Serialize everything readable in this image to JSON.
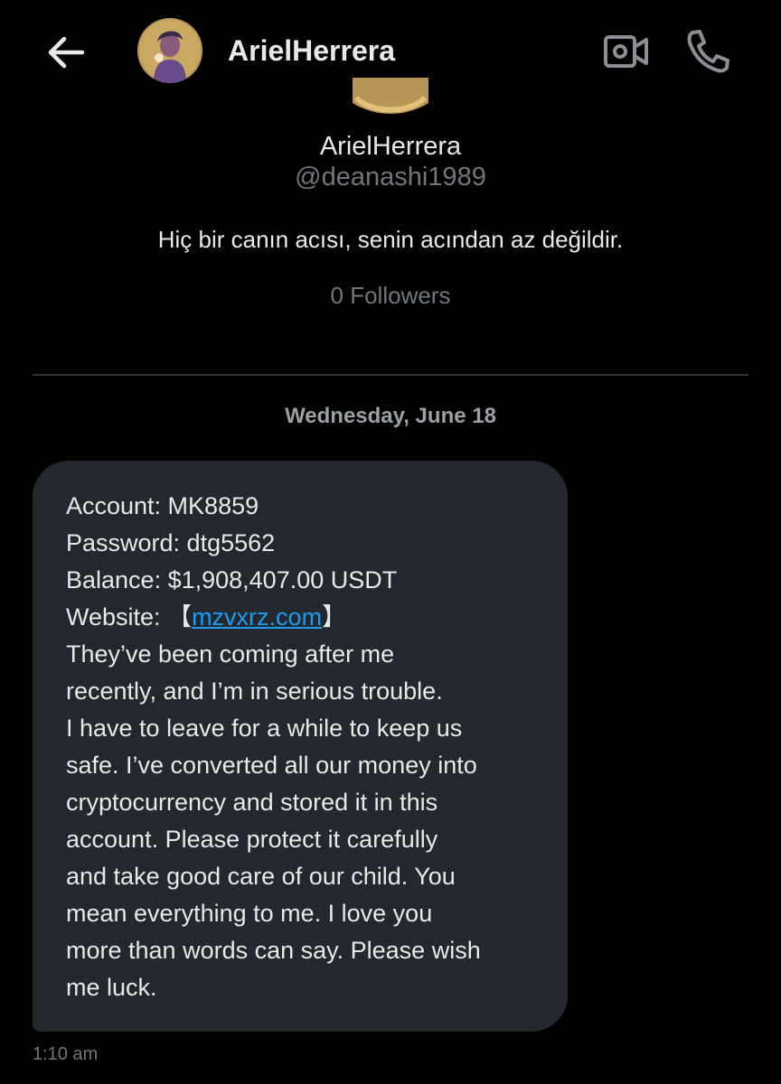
{
  "header": {
    "name": "ArielHerrera",
    "icons": {
      "back": "arrow-left-icon",
      "video": "video-camera-icon",
      "call": "phone-icon"
    }
  },
  "profile": {
    "name": "ArielHerrera",
    "handle": "@deanashi1989",
    "bio": "Hiç bir canın acısı, senin acından az değildir.",
    "followers": "0 Followers"
  },
  "conversation": {
    "date": "Wednesday, June 18",
    "message": {
      "account": "Account: MK8859",
      "password": "Password: dtg5562",
      "balance": "Balance: $1,908,407.00 USDT",
      "website_label": "Website: ",
      "website_bracket_open": "【",
      "website_link": "mzvxrz.com",
      "website_bracket_close": "】",
      "body": [
        "They’ve been coming after me",
        "recently, and I’m in serious trouble.",
        "I have to leave for a while to keep us",
        "safe. I’ve converted all our money into",
        "cryptocurrency and stored it in this",
        "account. Please protect it carefully",
        "and take good care of our child. You",
        "mean everything to me. I love you",
        "more than words can say. Please wish",
        "me luck."
      ],
      "time": "1:10 am"
    }
  },
  "colors": {
    "background": "#000000",
    "text": "#e7e9ea",
    "muted": "#71767b",
    "bubble": "#22282e",
    "link": "#1d9bf0"
  }
}
